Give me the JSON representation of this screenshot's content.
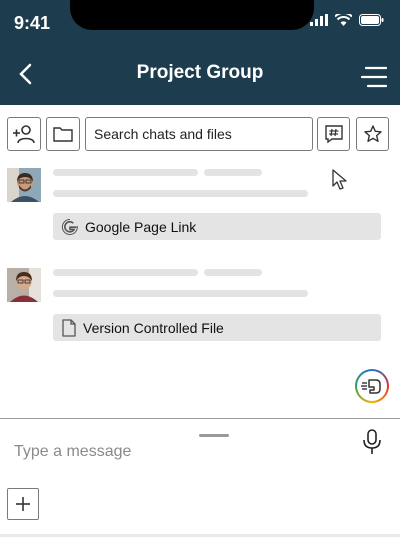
{
  "status_bar": {
    "time": "9:41"
  },
  "header": {
    "title": "Project Group"
  },
  "toolbar": {
    "search_placeholder": "Search chats and files"
  },
  "messages": [
    {
      "attachment": {
        "label": "Google Page Link",
        "icon": "google-icon"
      }
    },
    {
      "attachment": {
        "label": "Version Controlled File",
        "icon": "file-icon"
      }
    }
  ],
  "composer": {
    "placeholder": "Type a message"
  },
  "colors": {
    "header_bg": "#1d3d4e",
    "attachment_bg": "#e4e4e4",
    "skeleton": "#e3e3e3"
  }
}
